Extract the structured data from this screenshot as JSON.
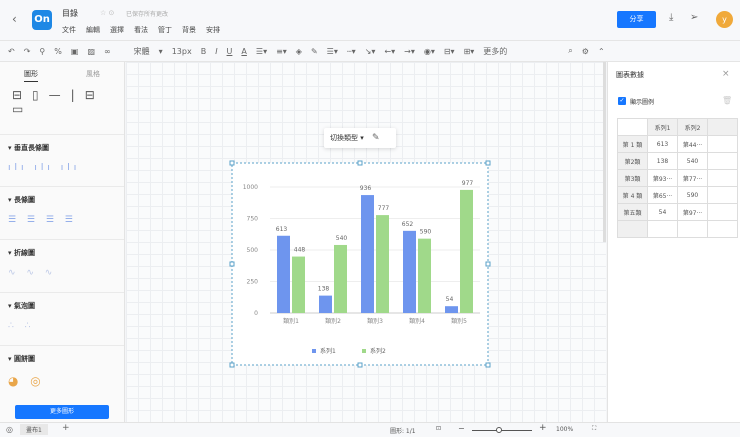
{
  "header": {
    "back": "‹",
    "logo": "On",
    "title": "目錄",
    "save_status": "已保存所有更改",
    "menu": [
      "文件",
      "編輯",
      "選擇",
      "看法",
      "管丁",
      "背景",
      "安排"
    ],
    "share": "分享",
    "avatar": "y"
  },
  "toolbar": {
    "font": "宋體",
    "size": "13px",
    "more": "更多的"
  },
  "sidebar": {
    "tabs": [
      "圖形",
      "風格"
    ],
    "sections": [
      "垂直長條圖",
      "長條圖",
      "折線圖",
      "氣泡圖",
      "圓餅圖"
    ],
    "more_button": "更多圖形"
  },
  "canvas": {
    "chart_type_label": "切換類型"
  },
  "panel": {
    "title": "圖表數據",
    "show_legend": "顯示圖例",
    "headers": [
      "",
      "系列1",
      "系列2"
    ],
    "rows": [
      [
        "第 1 類",
        "613",
        "第44···"
      ],
      [
        "第2類",
        "138",
        "540"
      ],
      [
        "第3類",
        "第93···",
        "第77···"
      ],
      [
        "第 4 類",
        "第65···",
        "590"
      ],
      [
        "第五類",
        "54",
        "第97···"
      ]
    ]
  },
  "status": {
    "page_tab": "畫布1",
    "shapes": "圖形: 1/1",
    "zoom": "100%"
  },
  "chart_data": {
    "type": "bar",
    "categories": [
      "類別1",
      "類別2",
      "類別3",
      "類別4",
      "類別5"
    ],
    "series": [
      {
        "name": "系列1",
        "values": [
          613,
          138,
          936,
          652,
          54
        ],
        "color": "#6e95ee"
      },
      {
        "name": "系列2",
        "values": [
          448,
          540,
          777,
          590,
          977
        ],
        "color": "#a0d98a"
      }
    ],
    "yticks": [
      0,
      250,
      500,
      750,
      1000
    ],
    "ylim": [
      0,
      1000
    ],
    "legend": "bottom",
    "grid": true
  }
}
